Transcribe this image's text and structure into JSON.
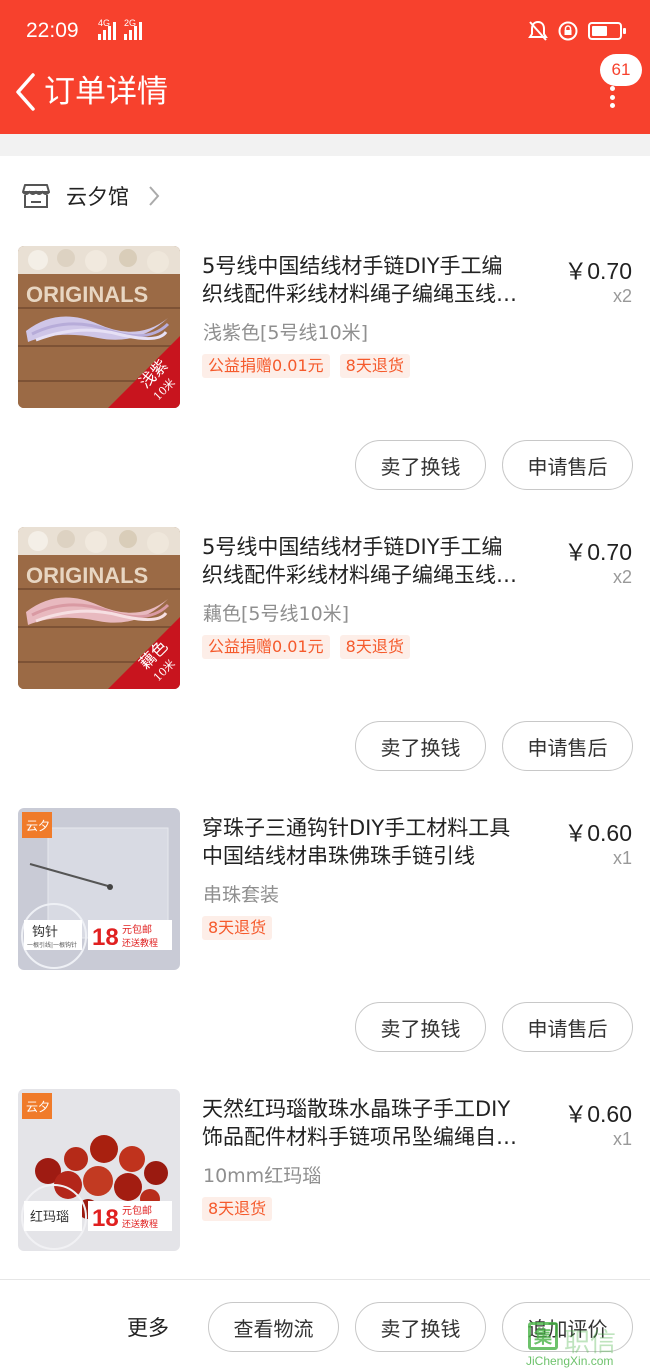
{
  "status_bar": {
    "time": "22:09",
    "net1": "4G",
    "net2": "2G"
  },
  "header": {
    "title": "订单详情",
    "badge": "61"
  },
  "shop": {
    "name": "云夕馆"
  },
  "items": [
    {
      "title_line1": "5号线中国结线材手链DIY手工编",
      "title_line2": "织线配件彩线材料绳子编绳玉线…",
      "price": "￥0.70",
      "qty": "x2",
      "spec": "浅紫色[5号线10米]",
      "tags": [
        "公益捐赠0.01元",
        "8天退货"
      ],
      "thumb_text": "ORIGINALS",
      "thumb_label": "浅紫",
      "thumb_sub": "10米",
      "btn1": "卖了换钱",
      "btn2": "申请售后"
    },
    {
      "title_line1": "5号线中国结线材手链DIY手工编",
      "title_line2": "织线配件彩线材料绳子编绳玉线…",
      "price": "￥0.70",
      "qty": "x2",
      "spec": "藕色[5号线10米]",
      "tags": [
        "公益捐赠0.01元",
        "8天退货"
      ],
      "thumb_text": "ORIGINALS",
      "thumb_label": "藕色",
      "thumb_sub": "10米",
      "btn1": "卖了换钱",
      "btn2": "申请售后"
    },
    {
      "title_line1": "穿珠子三通钩针DIY手工材料工具",
      "title_line2": "中国结线材串珠佛珠手链引线",
      "price": "￥0.60",
      "qty": "x1",
      "spec": "串珠套装",
      "tags": [
        "8天退货"
      ],
      "thumb_logo": "云夕",
      "thumb_label": "钩针",
      "thumb_sub": "一根引线|一根钩针",
      "promo_num": "18",
      "promo_a": "元包邮",
      "promo_b": "还送教程",
      "btn1": "卖了换钱",
      "btn2": "申请售后"
    },
    {
      "title_line1": "天然红玛瑙散珠水晶珠子手工DIY",
      "title_line2": "饰品配件材料手链项吊坠编绳自…",
      "price": "￥0.60",
      "qty": "x1",
      "spec": "10mm红玛瑙",
      "tags": [
        "8天退货"
      ],
      "thumb_logo": "云夕",
      "thumb_label": "红玛瑙",
      "promo_num": "18",
      "promo_a": "元包邮",
      "promo_b": "还送教程"
    }
  ],
  "bottom": {
    "more": "更多",
    "btn_logistics": "查看物流",
    "btn_sell": "卖了换钱",
    "btn_review": "追加评价"
  },
  "watermark": {
    "site": "JiChengXin.com",
    "logo": "集",
    "text": "职信"
  },
  "colors": {
    "brand": "#f7412d",
    "tag_bg": "#fdeee8",
    "tag_text": "#f55a2c",
    "watermark": "#49b447"
  }
}
